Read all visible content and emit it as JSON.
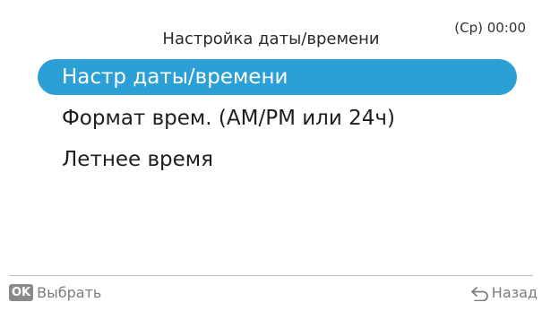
{
  "status": {
    "clock": "(Ср) 00:00"
  },
  "header": {
    "title": "Настройка даты/времени"
  },
  "menu": {
    "items": [
      {
        "label": "Настр даты/времени",
        "selected": true
      },
      {
        "label": "Формат врем. (AM/PM или 24ч)",
        "selected": false
      },
      {
        "label": "Летнее время",
        "selected": false
      }
    ]
  },
  "footer": {
    "ok_key": "OK",
    "select_label": "Выбрать",
    "back_label": "Назад",
    "back_icon": "return-arrow-icon"
  },
  "colors": {
    "selection": "#2c9fd7",
    "footer_text": "#7d7d7d"
  }
}
